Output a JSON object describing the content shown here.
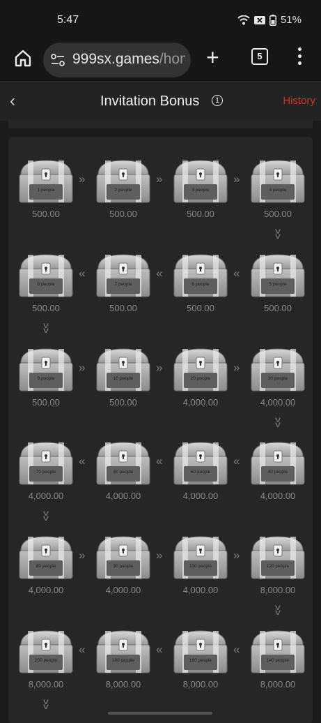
{
  "status_bar": {
    "time": "5:47",
    "battery": "51%"
  },
  "browser": {
    "url_host": "999sx.games",
    "url_path": "/hom",
    "tab_count": "5"
  },
  "header": {
    "title": "Invitation Bonus",
    "info_glyph": "1",
    "history": "History"
  },
  "rewards": [
    {
      "label": "1 people",
      "amount": "500.00"
    },
    {
      "label": "2 people",
      "amount": "500.00"
    },
    {
      "label": "3 people",
      "amount": "500.00"
    },
    {
      "label": "4 people",
      "amount": "500.00"
    },
    {
      "label": "8 people",
      "amount": "500.00"
    },
    {
      "label": "7 people",
      "amount": "500.00"
    },
    {
      "label": "6 people",
      "amount": "500.00"
    },
    {
      "label": "5 people",
      "amount": "500.00"
    },
    {
      "label": "9 people",
      "amount": "500.00"
    },
    {
      "label": "10 people",
      "amount": "500.00"
    },
    {
      "label": "20 people",
      "amount": "4,000.00"
    },
    {
      "label": "30 people",
      "amount": "4,000.00"
    },
    {
      "label": "70 people",
      "amount": "4,000.00"
    },
    {
      "label": "60 people",
      "amount": "4,000.00"
    },
    {
      "label": "50 people",
      "amount": "4,000.00"
    },
    {
      "label": "40 people",
      "amount": "4,000.00"
    },
    {
      "label": "80 people",
      "amount": "4,000.00"
    },
    {
      "label": "90 people",
      "amount": "4,000.00"
    },
    {
      "label": "100 people",
      "amount": "4,000.00"
    },
    {
      "label": "120 people",
      "amount": "8,000.00"
    },
    {
      "label": "200 people",
      "amount": "8,000.00"
    },
    {
      "label": "180 people",
      "amount": "8,000.00"
    },
    {
      "label": "160 people",
      "amount": "8,000.00"
    },
    {
      "label": "140 people",
      "amount": "8,000.00"
    }
  ],
  "colors": {
    "accent": "#d9342b",
    "background": "#1b1b1b",
    "card": "#262626"
  }
}
